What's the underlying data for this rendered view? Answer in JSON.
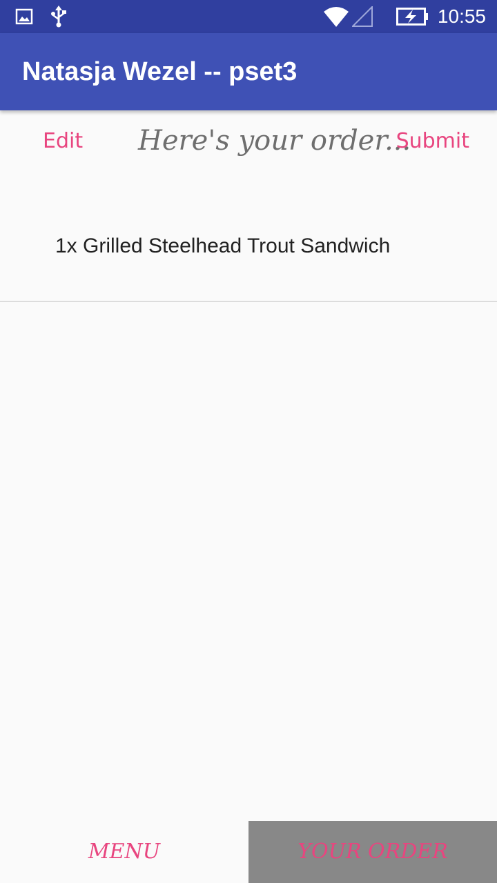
{
  "status_bar": {
    "time": "10:55",
    "icons": [
      "image-icon",
      "usb-icon",
      "wifi-icon",
      "signal-icon",
      "battery-charging-icon"
    ]
  },
  "app_bar": {
    "title": "Natasja Wezel -- pset3"
  },
  "order_header": {
    "edit_label": "Edit",
    "heading": "Here's your order...",
    "submit_label": "Submit"
  },
  "order_items": [
    "1x Grilled Steelhead Trout Sandwich"
  ],
  "bottom_nav": {
    "tabs": [
      {
        "label": "MENU"
      },
      {
        "label": "YOUR ORDER"
      }
    ]
  },
  "colors": {
    "status_bar": "#303f9f",
    "app_bar": "#3f51b5",
    "accent": "#e8457f",
    "active_tab_bg": "#888888"
  }
}
